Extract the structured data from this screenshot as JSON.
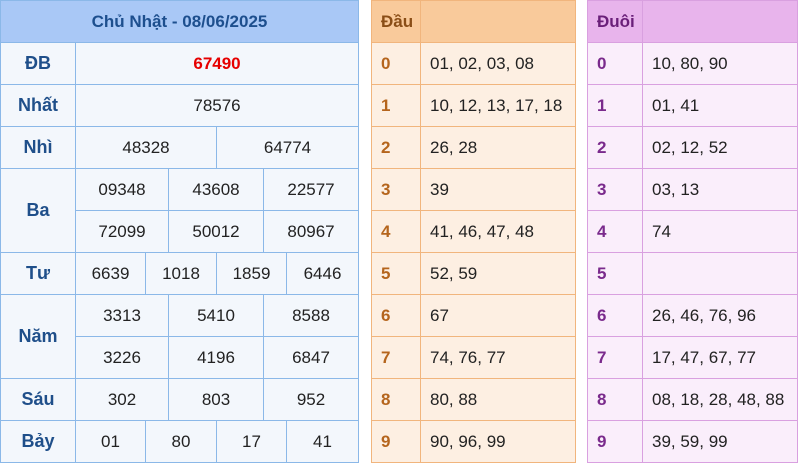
{
  "results": {
    "title": "Chủ Nhật - 08/06/2025",
    "special": {
      "label": "ĐB",
      "value": "67490"
    },
    "first": {
      "label": "Nhất",
      "value": "78576"
    },
    "second": {
      "label": "Nhì",
      "values": [
        "48328",
        "64774"
      ]
    },
    "third": {
      "label": "Ba",
      "values": [
        "09348",
        "43608",
        "22577",
        "72099",
        "50012",
        "80967"
      ]
    },
    "fourth": {
      "label": "Tư",
      "values": [
        "6639",
        "1018",
        "1859",
        "6446"
      ]
    },
    "fifth": {
      "label": "Năm",
      "values": [
        "3313",
        "5410",
        "8588",
        "3226",
        "4196",
        "6847"
      ]
    },
    "sixth": {
      "label": "Sáu",
      "values": [
        "302",
        "803",
        "952"
      ]
    },
    "seventh": {
      "label": "Bảy",
      "values": [
        "01",
        "80",
        "17",
        "41"
      ]
    }
  },
  "heads": {
    "title": "Đầu",
    "rows": [
      {
        "digit": "0",
        "values": "01, 02, 03, 08"
      },
      {
        "digit": "1",
        "values": "10, 12, 13, 17, 18"
      },
      {
        "digit": "2",
        "values": "26, 28"
      },
      {
        "digit": "3",
        "values": "39"
      },
      {
        "digit": "4",
        "values": "41, 46, 47, 48"
      },
      {
        "digit": "5",
        "values": "52, 59"
      },
      {
        "digit": "6",
        "values": "67"
      },
      {
        "digit": "7",
        "values": "74, 76, 77"
      },
      {
        "digit": "8",
        "values": "80, 88"
      },
      {
        "digit": "9",
        "values": "90, 96, 99"
      }
    ]
  },
  "tails": {
    "title": "Đuôi",
    "rows": [
      {
        "digit": "0",
        "values": "10, 80, 90"
      },
      {
        "digit": "1",
        "values": "01, 41"
      },
      {
        "digit": "2",
        "values": "02, 12, 52"
      },
      {
        "digit": "3",
        "values": "03, 13"
      },
      {
        "digit": "4",
        "values": "74"
      },
      {
        "digit": "5",
        "values": ""
      },
      {
        "digit": "6",
        "values": "26, 46, 76, 96"
      },
      {
        "digit": "7",
        "values": "17, 47, 67, 77"
      },
      {
        "digit": "8",
        "values": "08, 18, 28, 48, 88"
      },
      {
        "digit": "9",
        "values": "39, 59, 99"
      }
    ]
  }
}
